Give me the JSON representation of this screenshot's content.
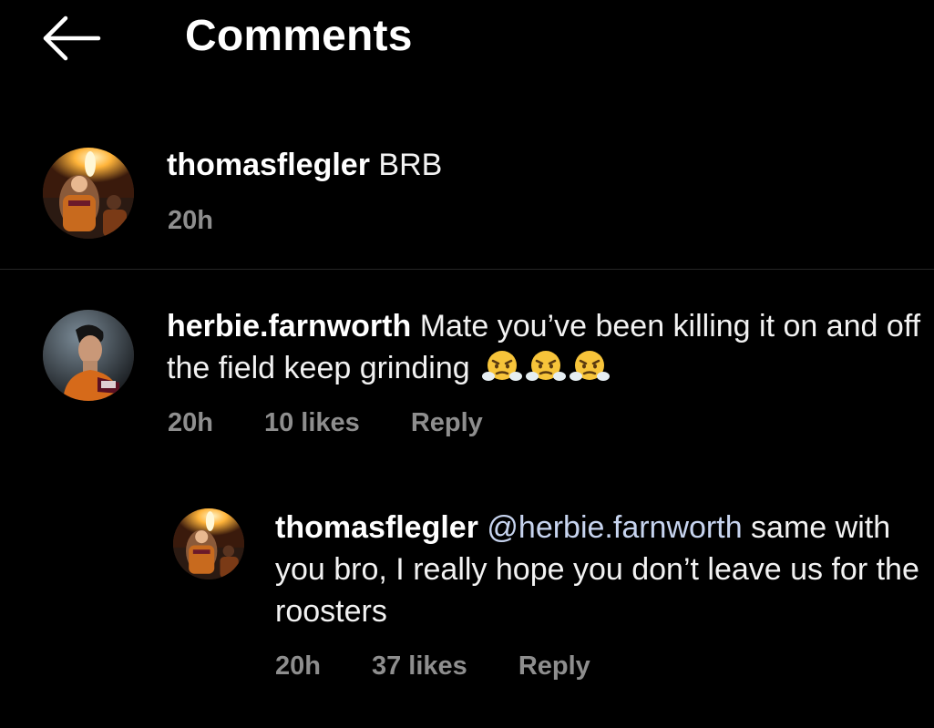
{
  "header": {
    "title": "Comments",
    "back_icon": "arrow-left-icon"
  },
  "comments": [
    {
      "username": "thomasflegler",
      "text": "BRB",
      "time": "20h",
      "avatar_icon": "avatar-thomasflegler"
    },
    {
      "username": "herbie.farnworth",
      "text": "Mate you’ve been killing it on and off the field keep grinding",
      "emoji": "face-with-steam-from-nose",
      "time": "20h",
      "likes": "10 likes",
      "reply_label": "Reply",
      "avatar_icon": "avatar-herbie-farnworth",
      "reply": {
        "username": "thomasflegler",
        "mention": "@herbie.farnworth",
        "text": " same with you bro, I really hope you don’t leave us for the roosters",
        "time": "20h",
        "likes": "37 likes",
        "reply_label": "Reply",
        "avatar_icon": "avatar-thomasflegler"
      }
    }
  ],
  "colors": {
    "background": "#000000",
    "text": "#f2f2f2",
    "meta": "#8e8e8e",
    "mention": "#c7d4ef",
    "divider": "#262626"
  }
}
